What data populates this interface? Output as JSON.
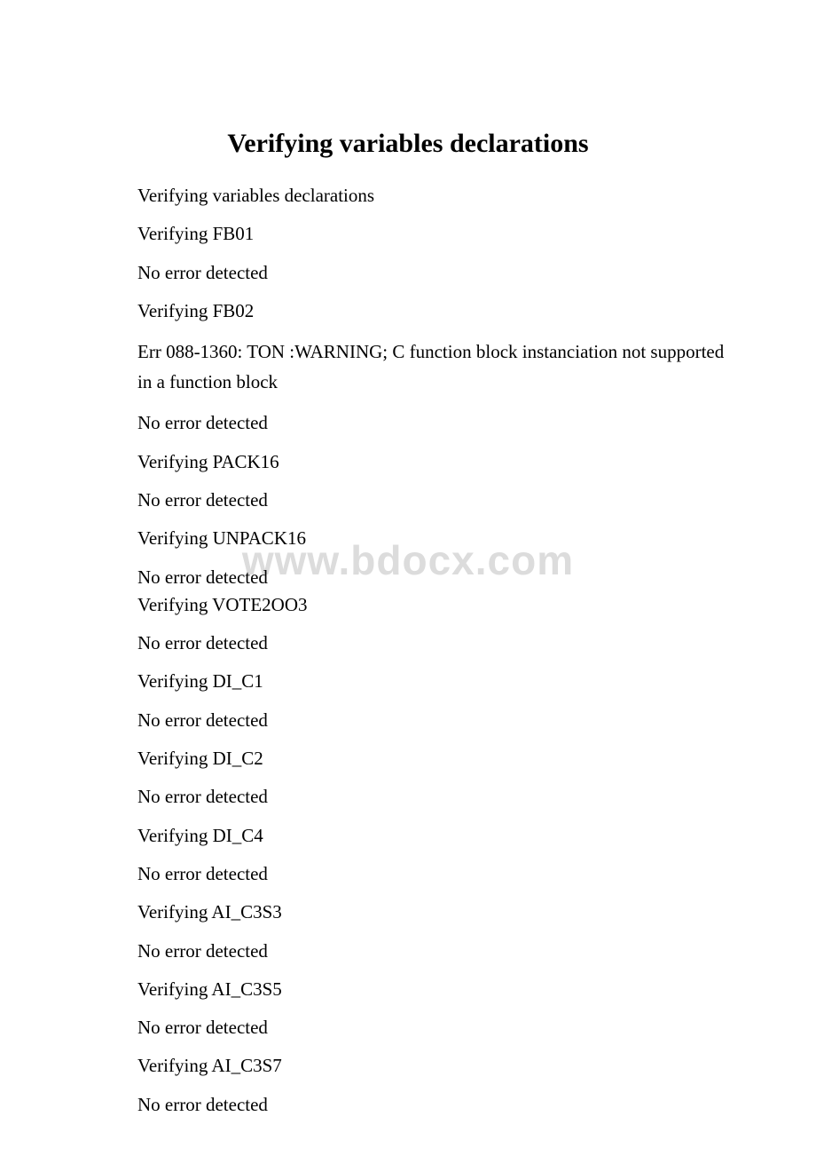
{
  "title": "Verifying variables declarations",
  "watermark": "www.bdocx.com",
  "lines": [
    {
      "text": "Verifying variables declarations"
    },
    {
      "text": "Verifying FB01"
    },
    {
      "text": "No error detected"
    },
    {
      "text": "Verifying FB02"
    },
    {
      "text": "Err 088-1360: TON :WARNING; C function block instanciation not supported in a function block",
      "wrap": true
    },
    {
      "text": "No error detected"
    },
    {
      "text": "Verifying PACK16"
    },
    {
      "text": "No error detected"
    },
    {
      "text": "Verifying UNPACK16"
    },
    {
      "text": "No error detected",
      "tightTop": true
    },
    {
      "text": "Verifying VOTE2OO3",
      "tightBottom": true
    },
    {
      "text": "No error detected"
    },
    {
      "text": "Verifying DI_C1"
    },
    {
      "text": "No error detected"
    },
    {
      "text": "Verifying DI_C2"
    },
    {
      "text": "No error detected"
    },
    {
      "text": "Verifying DI_C4"
    },
    {
      "text": "No error detected"
    },
    {
      "text": "Verifying AI_C3S3"
    },
    {
      "text": "No error detected"
    },
    {
      "text": "Verifying AI_C3S5"
    },
    {
      "text": "No error detected"
    },
    {
      "text": "Verifying AI_C3S7"
    },
    {
      "text": "No error detected"
    }
  ]
}
